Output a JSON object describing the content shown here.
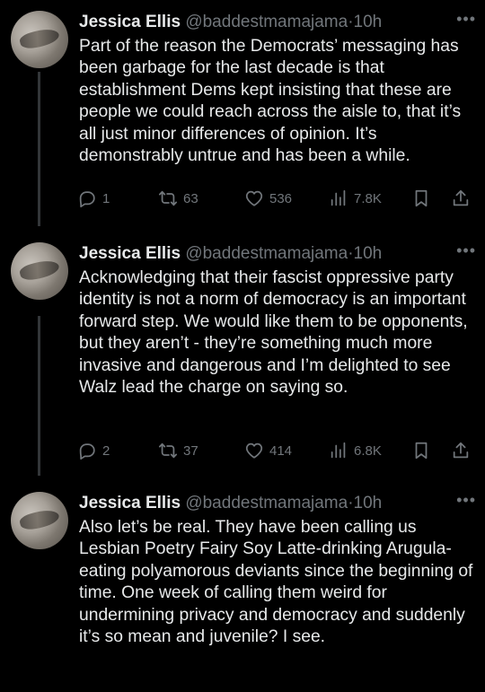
{
  "tweets": [
    {
      "name": "Jessica Ellis",
      "handle": "@baddestmamajama",
      "dot": "·",
      "time": "10h",
      "more": "•••",
      "text": "Part of the reason the Democrats’ messaging has been garbage for the last decade is that establishment Dems kept insisting that these are people we could reach across the aisle to, that it’s all just minor differences of opinion. It’s demonstrably untrue and has been a while.",
      "replies": "1",
      "reposts": "63",
      "likes": "536",
      "views": "7.8K"
    },
    {
      "name": "Jessica Ellis",
      "handle": "@baddestmamajama",
      "dot": "·",
      "time": "10h",
      "more": "•••",
      "text": "Acknowledging that their fascist oppressive party identity is not a norm of democracy is an important forward step. We would like them to be opponents, but they aren’t - they’re something much more invasive and dangerous and I’m delighted to see Walz lead the charge on saying so.",
      "replies": "2",
      "reposts": "37",
      "likes": "414",
      "views": "6.8K"
    },
    {
      "name": "Jessica Ellis",
      "handle": "@baddestmamajama",
      "dot": "·",
      "time": "10h",
      "more": "•••",
      "text": "Also let’s be real. They have been calling us Lesbian Poetry Fairy Soy Latte-drinking Arugula-eating polyamorous deviants since the beginning of time. One week of calling them weird for undermining privacy and democracy and suddenly it’s so mean and juvenile? I see."
    }
  ],
  "icons": [
    "reply-icon",
    "repost-icon",
    "like-icon",
    "views-icon",
    "bookmark-icon",
    "share-icon"
  ],
  "colors": {
    "background": "#000000",
    "text": "#e7e9ea",
    "muted": "#71767b",
    "thread_line": "#333639"
  }
}
